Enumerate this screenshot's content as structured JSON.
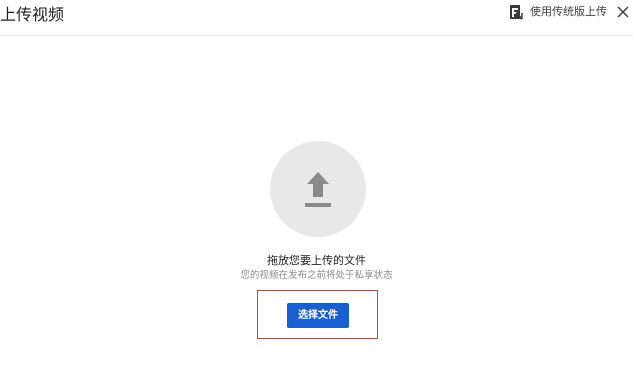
{
  "header": {
    "title": "上传视频",
    "legacy_upload_label": "使用传统版上传",
    "legacy_icon": "legacy-upload-icon",
    "close_icon": "close-icon"
  },
  "main": {
    "upload_icon": "upload-arrow-icon",
    "drop_title": "拖放您要上传的文件",
    "drop_subtitle": "您的视频在发布之前将处于私享状态",
    "select_button_label": "选择文件"
  },
  "colors": {
    "accent": "#1a5fd1",
    "highlight": "#e53935",
    "circle_bg": "#e8e8e8",
    "icon_gray": "#8a8a8a"
  }
}
